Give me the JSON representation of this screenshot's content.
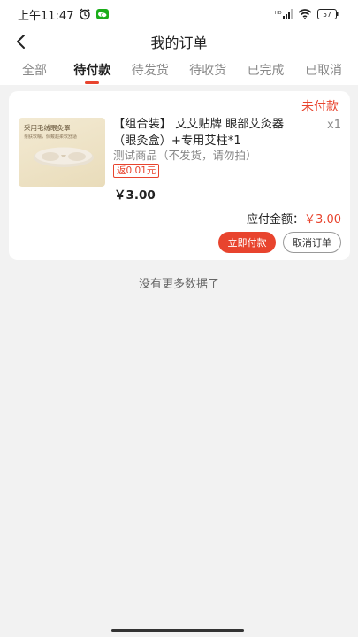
{
  "status_bar": {
    "time": "上午11:47",
    "network_label": "HD",
    "battery": "57"
  },
  "header": {
    "title": "我的订单"
  },
  "tabs": [
    {
      "label": "全部",
      "active": false
    },
    {
      "label": "待付款",
      "active": true
    },
    {
      "label": "待发货",
      "active": false
    },
    {
      "label": "待收货",
      "active": false
    },
    {
      "label": "已完成",
      "active": false
    },
    {
      "label": "已取消",
      "active": false
    }
  ],
  "order": {
    "status": "未付款",
    "thumbnail": {
      "title": "采用毛绒眼灸罩",
      "subtitle": "亲肤软糯，佩戴超柔软舒适"
    },
    "product_name": "【组合装】 艾艾贴牌 眼部艾灸器（眼灸盒）+专用艾柱*1",
    "quantity": "x1",
    "description": "测试商品（不发货，请勿拍）",
    "rebate": "返0.01元",
    "price": "￥3.00",
    "payable_label": "应付金额：",
    "payable_amount": "￥3.00",
    "pay_button": "立即付款",
    "cancel_button": "取消订单"
  },
  "footer": {
    "no_more": "没有更多数据了"
  },
  "colors": {
    "accent": "#e8442e",
    "background": "#f2f2f2"
  }
}
